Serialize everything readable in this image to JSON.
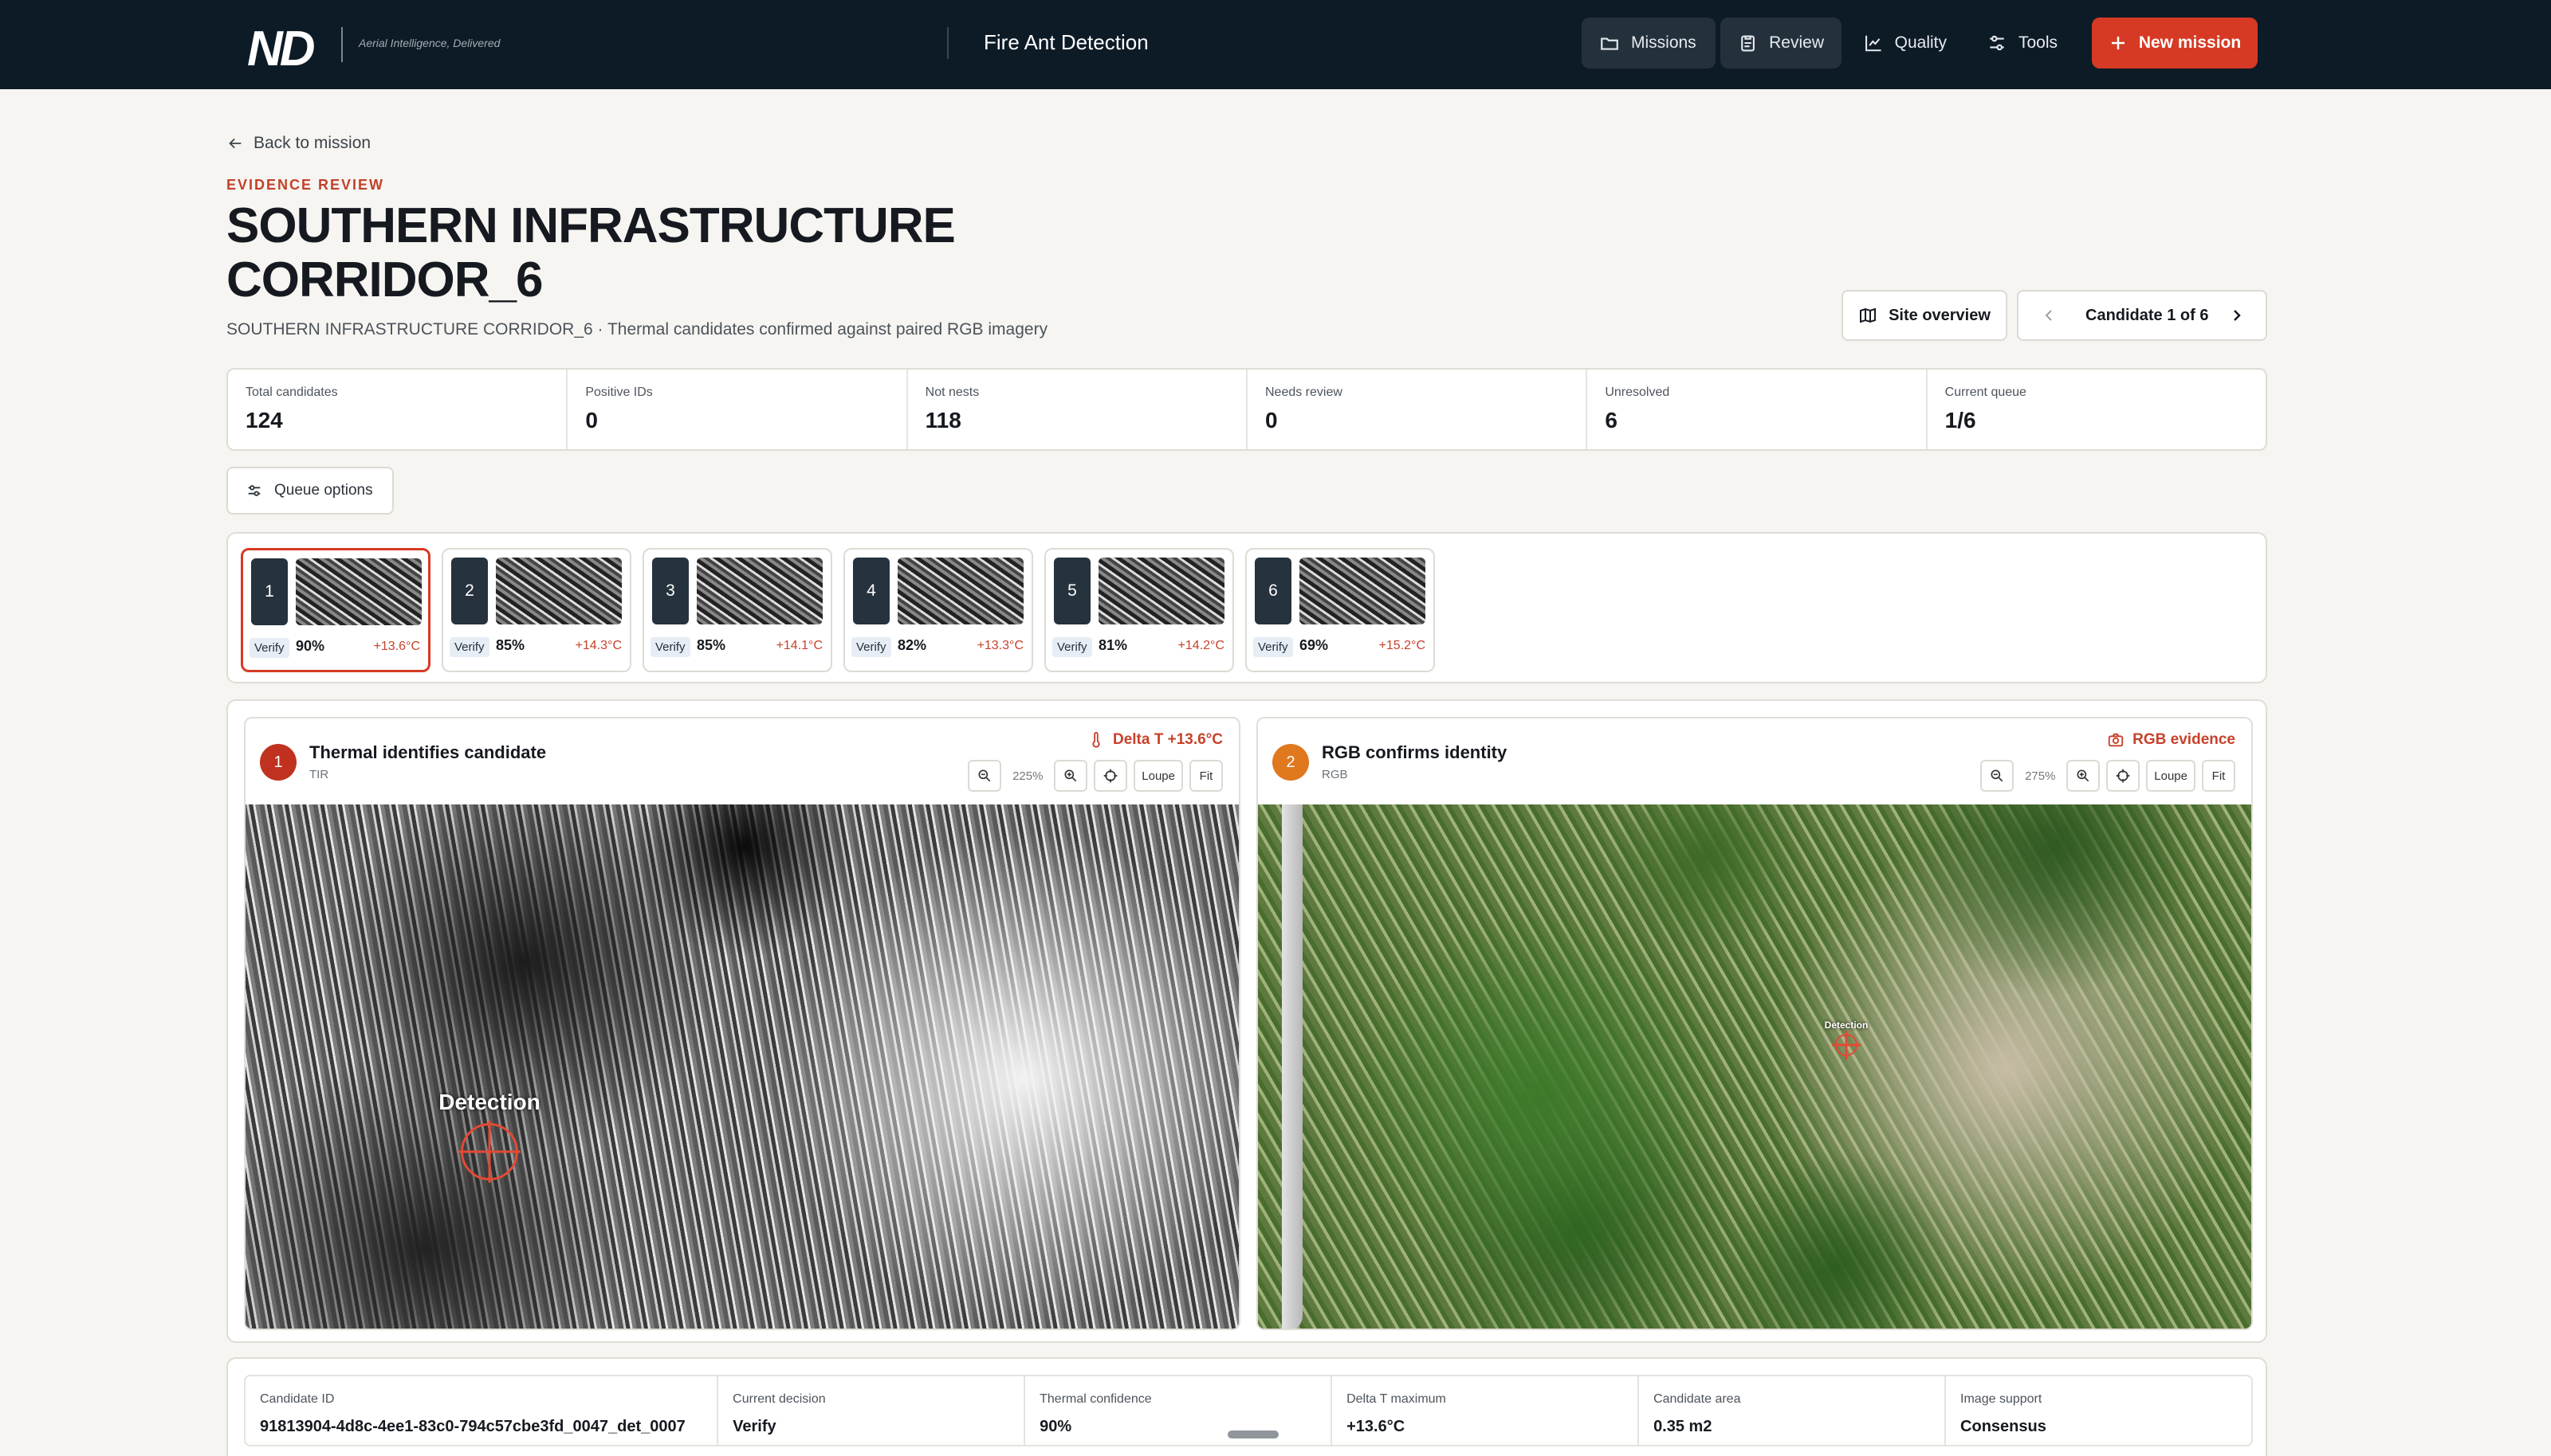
{
  "header": {
    "logo": "ND",
    "tagline": "Aerial Intelligence, Delivered",
    "app_title": "Fire Ant Detection",
    "nav": [
      {
        "label": "Missions",
        "icon": "folder-icon"
      },
      {
        "label": "Review",
        "icon": "clipboard-icon"
      },
      {
        "label": "Quality",
        "icon": "chart-icon"
      },
      {
        "label": "Tools",
        "icon": "sliders-icon"
      }
    ],
    "new_mission": "New mission"
  },
  "page": {
    "back": "Back to mission",
    "eyebrow": "EVIDENCE REVIEW",
    "title": "SOUTHERN INFRASTRUCTURE CORRIDOR_6",
    "subtitle": "SOUTHERN INFRASTRUCTURE CORRIDOR_6 · Thermal candidates confirmed against paired RGB imagery",
    "site_overview": "Site overview",
    "candidate_nav": "Candidate 1 of 6"
  },
  "stats": [
    {
      "label": "Total candidates",
      "value": "124"
    },
    {
      "label": "Positive IDs",
      "value": "0"
    },
    {
      "label": "Not nests",
      "value": "118"
    },
    {
      "label": "Needs review",
      "value": "0"
    },
    {
      "label": "Unresolved",
      "value": "6"
    },
    {
      "label": "Current queue",
      "value": "1/6"
    }
  ],
  "queue_options": "Queue options",
  "candidates": [
    {
      "num": "1",
      "status": "Verify",
      "conf": "90%",
      "delta": "+13.6°C"
    },
    {
      "num": "2",
      "status": "Verify",
      "conf": "85%",
      "delta": "+14.3°C"
    },
    {
      "num": "3",
      "status": "Verify",
      "conf": "85%",
      "delta": "+14.1°C"
    },
    {
      "num": "4",
      "status": "Verify",
      "conf": "82%",
      "delta": "+13.3°C"
    },
    {
      "num": "5",
      "status": "Verify",
      "conf": "81%",
      "delta": "+14.2°C"
    },
    {
      "num": "6",
      "status": "Verify",
      "conf": "69%",
      "delta": "+15.2°C"
    }
  ],
  "thermal": {
    "step": "1",
    "title": "Thermal identifies candidate",
    "sub": "TIR",
    "tag": "Delta T +13.6°C",
    "zoom": "225%",
    "loupe": "Loupe",
    "fit": "Fit",
    "detection": "Detection"
  },
  "rgb": {
    "step": "2",
    "title": "RGB confirms identity",
    "sub": "RGB",
    "tag": "RGB evidence",
    "zoom": "275%",
    "loupe": "Loupe",
    "fit": "Fit",
    "detection": "Detection"
  },
  "details": [
    {
      "label": "Candidate ID",
      "value": "91813904-4d8c-4ee1-83c0-794c57cbe3fd_0047_det_0007"
    },
    {
      "label": "Current decision",
      "value": "Verify"
    },
    {
      "label": "Thermal confidence",
      "value": "90%"
    },
    {
      "label": "Delta T maximum",
      "value": "+13.6°C"
    },
    {
      "label": "Candidate area",
      "value": "0.35 m2"
    },
    {
      "label": "Image support",
      "value": "Consensus"
    }
  ],
  "colors": {
    "header_bg": "#0d1b27",
    "accent": "#d63a24",
    "thermal_badge": "#c0321f",
    "rgb_badge": "#e0781e"
  }
}
